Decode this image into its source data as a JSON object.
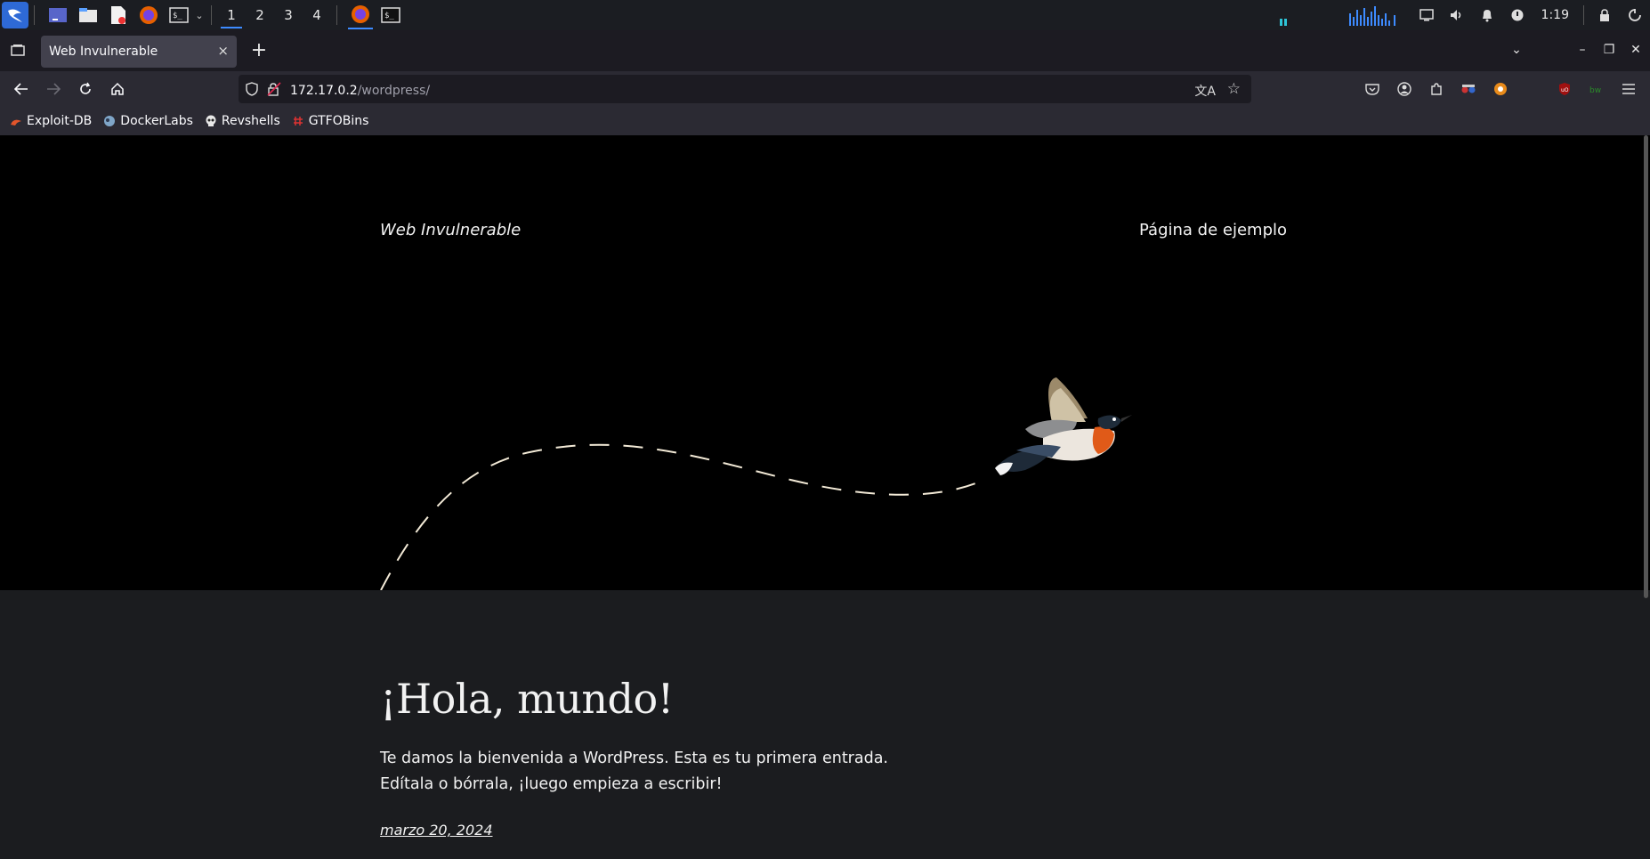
{
  "taskbar": {
    "workspaces": [
      "1",
      "2",
      "3",
      "4"
    ],
    "active_workspace": "1",
    "clock": "1:19"
  },
  "browser": {
    "tab_title": "Web Invulnerable",
    "tab_close": "×",
    "new_tab": "+",
    "url_host": "172.17.0.2",
    "url_path": "/wordpress/",
    "bookmarks": [
      {
        "label": "Exploit-DB",
        "icon": "exploitdb-icon"
      },
      {
        "label": "DockerLabs",
        "icon": "dockerlabs-icon"
      },
      {
        "label": "Revshells",
        "icon": "skull-icon"
      },
      {
        "label": "GTFOBins",
        "icon": "gtfobins-icon"
      }
    ]
  },
  "page": {
    "site_title": "Web Invulnerable",
    "nav_link": "Página de ejemplo",
    "post_title": "¡Hola, mundo!",
    "post_body": "Te damos la bienvenida a WordPress. Esta es tu primera entrada. Edítala o bórrala, ¡luego empieza a escribir!",
    "post_date": "marzo 20, 2024"
  },
  "colors": {
    "accent": "#3d8bff",
    "hero_bg": "#000000",
    "post_bg": "#1b1c1f"
  }
}
